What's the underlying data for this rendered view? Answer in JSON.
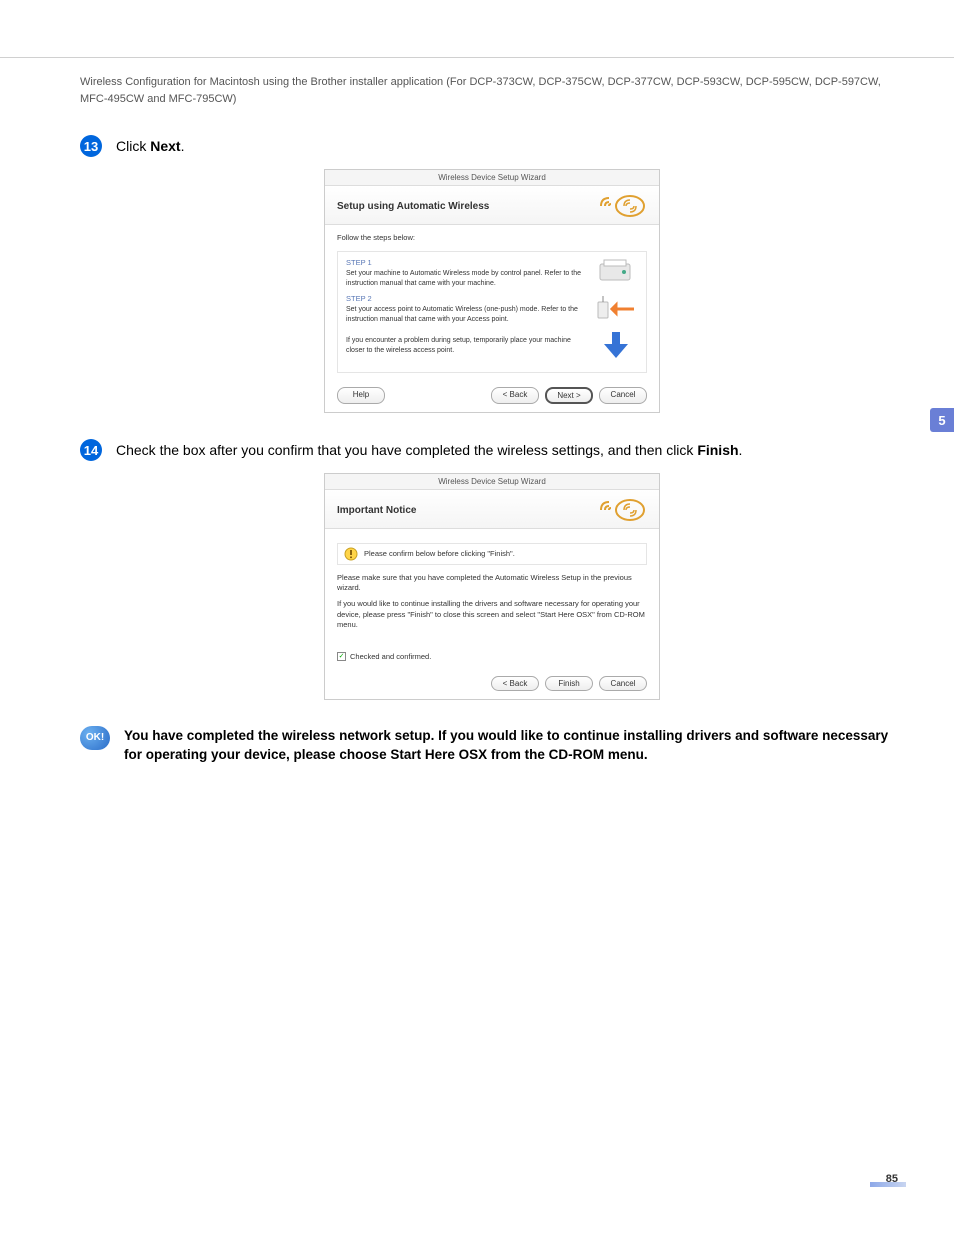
{
  "header": "Wireless Configuration for Macintosh using the Brother installer application (For DCP-373CW, DCP-375CW, DCP-377CW, DCP-593CW, DCP-595CW, DCP-597CW, MFC-495CW and MFC-795CW)",
  "sideTab": "5",
  "step13": {
    "num": "13",
    "prefix": "Click ",
    "bold": "Next",
    "suffix": "."
  },
  "step14": {
    "num": "14",
    "prefix": "Check the box after you confirm that you have completed the wireless settings, and then click ",
    "bold": "Finish",
    "suffix": "."
  },
  "wizard1": {
    "titlebar": "Wireless Device Setup Wizard",
    "heading": "Setup using Automatic Wireless",
    "intro": "Follow the steps below:",
    "s1label": "STEP 1",
    "s1text": "Set your machine to Automatic Wireless mode by control panel.\nRefer to the instruction manual that came with your machine.",
    "s2label": "STEP 2",
    "s2text": "Set your access point to Automatic Wireless (one-push) mode.\nRefer to the instruction manual that came with your Access point.",
    "note": "If you encounter a problem during setup, temporarily place your machine closer to the wireless access point.",
    "help": "Help",
    "back": "< Back",
    "next": "Next >",
    "cancel": "Cancel"
  },
  "wizard2": {
    "titlebar": "Wireless Device Setup Wizard",
    "heading": "Important Notice",
    "noticeBar": "Please confirm below before clicking \"Finish\".",
    "p1": "Please make sure that you have completed the Automatic Wireless Setup in the previous wizard.",
    "p2": "If you would like to continue installing the drivers and software necessary for operating your device, please press \"Finish\" to close this screen and select \"Start Here OSX\" from CD-ROM menu.",
    "checkLabel": "Checked and confirmed.",
    "back": "< Back",
    "finish": "Finish",
    "cancel": "Cancel"
  },
  "okBadge": "OK!",
  "okText": "You have completed the wireless network setup. If you would like to continue installing drivers and software necessary for operating your device, please choose Start Here OSX from the CD-ROM menu.",
  "pageNum": "85"
}
